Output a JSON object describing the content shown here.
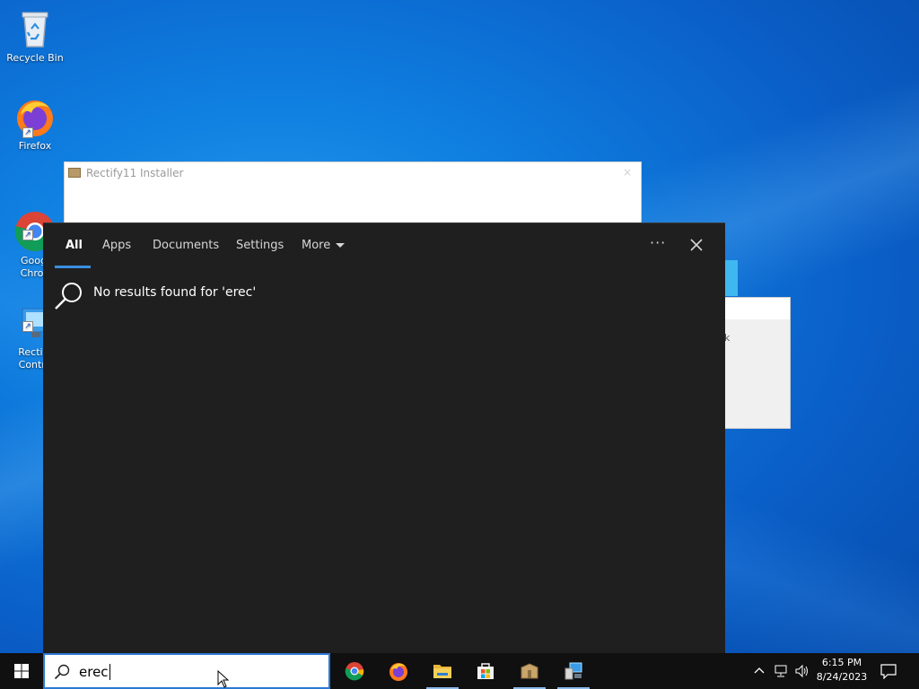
{
  "desktop": {
    "icons": [
      {
        "label": "Recycle Bin"
      },
      {
        "label": "Firefox"
      },
      {
        "label": "Googl\nChron"
      },
      {
        "label": "Rectify\nContro"
      }
    ]
  },
  "installer_window": {
    "title": "Rectify11 Installer",
    "close_glyph": "×"
  },
  "background_dialog": {
    "mark": "k"
  },
  "search_panel": {
    "tabs": [
      {
        "label": "All",
        "active": true
      },
      {
        "label": "Apps"
      },
      {
        "label": "Documents"
      },
      {
        "label": "Settings"
      },
      {
        "label": "More"
      }
    ],
    "options_glyph": "···",
    "no_results_text": "No results found for 'erec'",
    "accent": "#3a8fe0"
  },
  "taskbar": {
    "search_query": "erec",
    "apps": [
      "chrome-icon",
      "firefox-icon",
      "file-explorer-icon",
      "microsoft-store-icon",
      "installer-package-icon",
      "control-panel-icon"
    ],
    "clock": {
      "time": "6:15 PM",
      "date": "8/24/2023"
    }
  }
}
